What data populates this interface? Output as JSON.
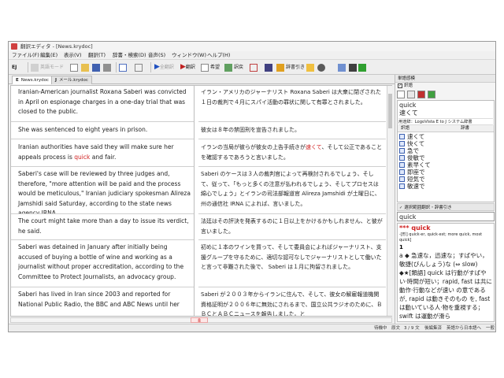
{
  "window": {
    "title": "翻訳エディタ - [News.krydoc]"
  },
  "menu": [
    "ファイル(F)",
    "編集(E)",
    "表示(V)",
    "翻訳(T)",
    "辞書・検索(D)",
    "音声(S)",
    "ウィンドウ(W)",
    "ヘルプ(H)"
  ],
  "toolbar": {
    "direction": "EJ",
    "disabled_1": "英語モード",
    "disabled_2": "全翻訳",
    "translate_label": "翻訳",
    "hope_label": "希望",
    "reverse_label": "訳戻",
    "dict_label": "辞書引き"
  },
  "tabs": [
    {
      "key": "E",
      "label": "News.krydoc"
    },
    {
      "key": "J",
      "label": "メール.krydoc"
    }
  ],
  "segments": [
    {
      "src": "Iranian-American journalist Roxana Saberi was convicted in April on espionage charges in a one-day trial that was closed to the public.",
      "tgt": "イラン・アメリカのジャーナリスト Roxana Saberi は大衆に閉ざされた１日の裁判で４月にスパイ活動の罪状に関して有罪とされました。"
    },
    {
      "src": "She was sentenced to eight years in prison.",
      "tgt": "彼女は８年の禁固刑を宣告されました。"
    },
    {
      "src_before": "Iranian authorities have said they will make sure her appeals process is ",
      "src_highlight": "quick",
      "src_after": " and fair.",
      "tgt_before": "イランの当局が彼らが彼女の上告手続きが",
      "tgt_highlight": "速くて",
      "tgt_after": "、そして公正であることを確認するであろうと言いました。"
    },
    {
      "src": "Saberi's case will be reviewed by three judges and, therefore, \"more attention will be paid and the process would be meticulous,\" Iranian judiciary spokesman Alireza Jamshidi said Saturday, according to the state news agency IRNA.",
      "tgt": "Saberi のケースは３人の裁判官によって再検討されるでしょう、そして、従って、「もっと多くの注意が払われるでしょう、そしてプロセスは綿心でしょう」とイランの司法部報道官 Alireza Jamshidi が土曜日に、州の通信社 IRNA によれば、言いました。"
    },
    {
      "src": "The court might take more than a day to issue its verdict, he said.",
      "tgt": "法廷はその評決を発表するのに１日以上をかけるかもしれません、と彼が言いました。"
    },
    {
      "src": "Saberi was detained in January after initially being accused of buying a bottle of wine and working as a journalist without proper accreditation, according to the Committee to Protect Journalists, an advocacy group.",
      "tgt": "初めに１本のワインを買って、そして委員会によればジャーナリスト、支援グループを守るために、適切な認可なしでジャーナリストとして働いたと言って非難された後で、 Saberi は１月に拘留されました。"
    },
    {
      "src": "Saberi has lived in Iran since 2003 and reported for National Public Radio, the BBC and ABC News until her",
      "tgt": "Saberi が２００３年からイランに住んで、そして、彼女の解雇報道機関資格証明が２００６年に無効にされるまで、国立公共ラジオのために、ＢＢＣとＡＢＣニュースを報告しました。と"
    }
  ],
  "hscroll_mark": "8",
  "status": {
    "mode": "待機中",
    "pane": "原文",
    "position": "3 / 9 文",
    "state": "後編集済",
    "direction": "英語から日本語へ",
    "tail": "一般"
  },
  "rightpanel": {
    "title": "単語感模",
    "checkbox_label": "訳語",
    "word": "quick",
    "translation": "速くて",
    "dict_source": "用途辞：LogoVista E to J システム辞書",
    "col_translation": "訳語",
    "col_dict": "辞書",
    "candidates": [
      "速くて",
      "快くて",
      "急で",
      "俊敏で",
      "素早くて",
      "即座で",
      "短気で",
      "敏速で"
    ],
    "lookup_title": "選択範囲翻訳・辞書引き",
    "search_value": "quick",
    "dict_entry": {
      "headword": "*** quick",
      "forms": "-[形] quick·er, quick·est; more quick, most quick]",
      "sense_num": "1",
      "sense_1": "a ◆ 急速な，迅速な；すばやい，敏捷(びんしょう)な (⇔ slow) ◆★[類語] quick は行動がすばやい·時間が短い；rapid, fast は共に動作·行動などが速い の意であるが, rapid は動きそのもの を, fast は動いている人·物を重視する；swift は運動が滑ら"
    }
  }
}
